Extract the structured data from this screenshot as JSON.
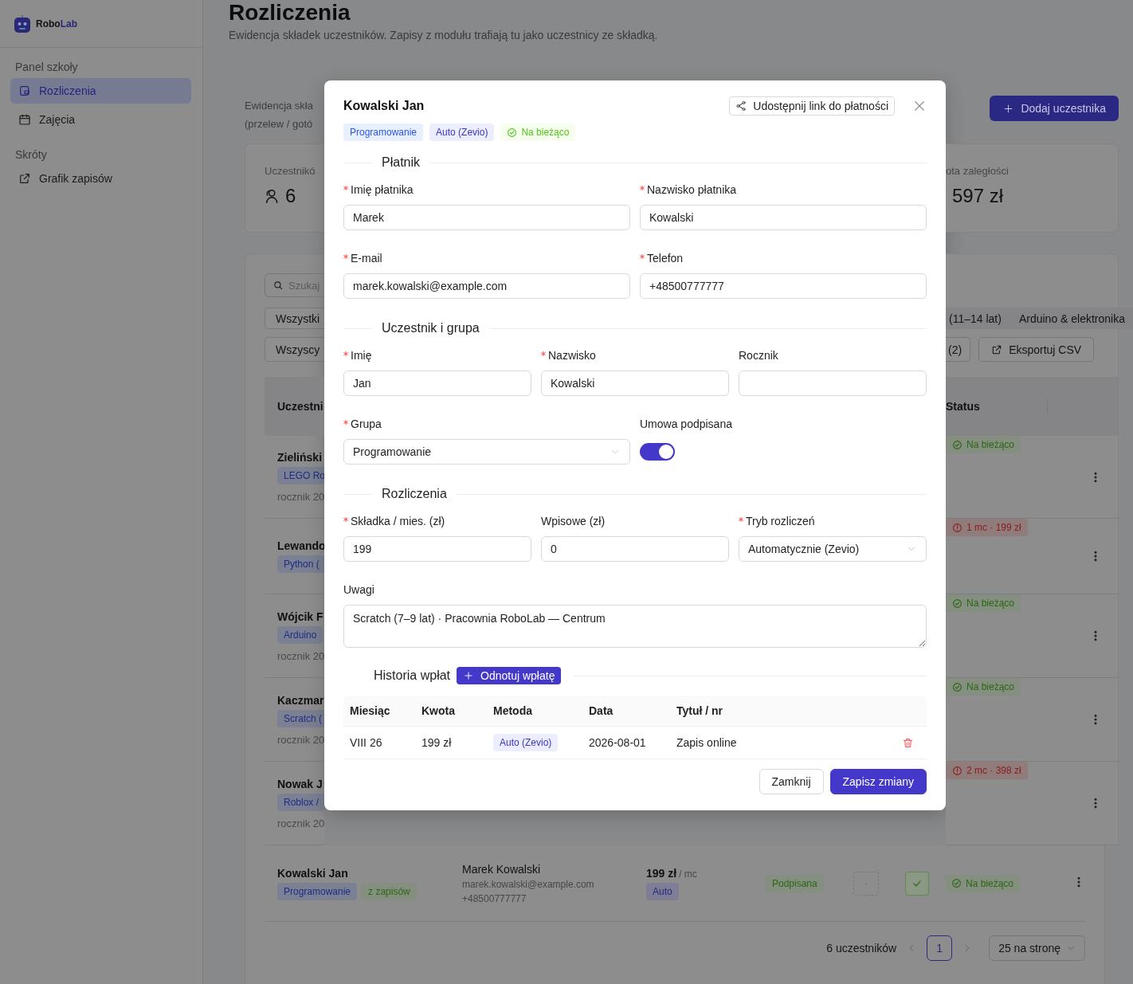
{
  "sidebar": {
    "logo": {
      "brand_1": "Robo",
      "brand_2": "Lab"
    },
    "sections": [
      {
        "title": "Panel szkoły",
        "items": [
          {
            "label": "Rozliczenia",
            "selected": true
          },
          {
            "label": "Zajęcia",
            "selected": false
          }
        ]
      },
      {
        "title": "Skróty",
        "items": [
          {
            "label": "Grafik zapisów",
            "selected": false
          }
        ]
      }
    ]
  },
  "page": {
    "title": "Rozliczenia",
    "subtitle": "Ewidencja składek uczestników. Zapisy z modułu trafiają tu jako uczestnicy ze składką.",
    "description": [
      "Ewidencja skła",
      "(przelew / gotó"
    ],
    "add_button": "Dodaj uczestnika",
    "stats": [
      {
        "label": "Uczestnikó",
        "value": "6"
      },
      {
        "label": "ota zaległości",
        "value": "597 zł"
      }
    ],
    "search": {
      "placeholder": "Szukaj"
    },
    "filters_left": [
      "Wszystki",
      "Wszyscy"
    ],
    "group_filters": [
      "(11–14 lat)",
      "Arduino & elektronika"
    ],
    "count_button": "(2)",
    "export_button": "Eksportuj CSV",
    "columns": [
      "Uczestni",
      "Status"
    ],
    "rows": [
      {
        "name": "Zieliński",
        "group": "LEGO Ro",
        "year": "rocznik 20",
        "status": "Na bieżąco",
        "kind": "ok"
      },
      {
        "name": "Lewando",
        "group": "Python (",
        "status": "1 mc · 199 zł",
        "kind": "overdue"
      },
      {
        "name": "Wójcik F",
        "group": "Arduino",
        "year": "rocznik 20",
        "status": "Na bieżąco",
        "kind": "ok"
      },
      {
        "name": "Kaczmar",
        "group": "Scratch (",
        "year": "rocznik 20",
        "status": "Na bieżąco",
        "kind": "ok"
      },
      {
        "name": "Nowak J",
        "group": "Roblox /",
        "year": "rocznik 20",
        "status": "2 mc · 398 zł",
        "kind": "overdue"
      }
    ],
    "last_row": {
      "name": "Kowalski Jan",
      "tags": [
        {
          "label": "Programowanie",
          "kind": "group"
        },
        {
          "label": "z zapisów",
          "kind": "source"
        }
      ],
      "payer": "Marek Kowalski",
      "email": "marek.kowalski@example.com",
      "phone": "+48500777777",
      "fee": "199 zł",
      "fee_unit": "/ mc",
      "mode": "Auto",
      "contract": "Podpisana",
      "column_6": "·",
      "checked": true,
      "status": "Na bieżąco",
      "kind": "ok"
    },
    "pagination": {
      "total": "6 uczestników",
      "pages": [
        {
          "label": "1",
          "selected": true
        }
      ],
      "page_size": "25 na stronę"
    }
  },
  "modal": {
    "title": "Kowalski Jan",
    "share_button": "Udostępnij link do płatności",
    "tags": [
      {
        "label": "Programowanie",
        "kind": "group"
      },
      {
        "label": "Auto (Zevio)",
        "kind": "method"
      },
      {
        "label": "Na bieżąco",
        "kind": "ok"
      }
    ],
    "sections": [
      {
        "title": "Płatnik",
        "rows": [
          [
            {
              "kind": "input",
              "label": "Imię płatnika",
              "required": true,
              "value": "Marek"
            },
            {
              "kind": "input",
              "label": "Nazwisko płatnika",
              "required": true,
              "value": "Kowalski"
            }
          ],
          [
            {
              "kind": "input",
              "label": "E-mail",
              "required": true,
              "value": "marek.kowalski@example.com"
            },
            {
              "kind": "input",
              "label": "Telefon",
              "required": true,
              "value": "+48500777777"
            }
          ]
        ]
      },
      {
        "title": "Uczestnik i grupa",
        "rows": [
          [
            {
              "kind": "input",
              "label": "Imię",
              "required": true,
              "value": "Jan"
            },
            {
              "kind": "input",
              "label": "Nazwisko",
              "required": true,
              "value": "Kowalski"
            },
            {
              "kind": "input",
              "label": "Rocznik",
              "required": false
            }
          ],
          [
            {
              "kind": "select",
              "label": "Grupa",
              "required": true,
              "value": "Programowanie"
            },
            {
              "kind": "toggle",
              "label": "Umowa podpisana",
              "required": false,
              "on": true
            }
          ]
        ]
      },
      {
        "title": "Rozliczenia",
        "rows": [
          [
            {
              "kind": "input",
              "label": "Składka / mies. (zł)",
              "required": true,
              "value": "199"
            },
            {
              "kind": "input",
              "label": "Wpisowe (zł)",
              "required": false,
              "value": "0"
            },
            {
              "kind": "select",
              "label": "Tryb rozliczeń",
              "required": true,
              "value": "Automatycznie (Zevio)"
            }
          ],
          [
            {
              "kind": "textarea",
              "label": "Uwagi",
              "required": false,
              "value": "Scratch (7–9 lat) · Pracownia RoboLab — Centrum"
            }
          ]
        ]
      }
    ],
    "history": {
      "title": "Historia wpłat",
      "action_button": "Odnotuj wpłatę",
      "columns": [
        "Miesiąc",
        "Kwota",
        "Metoda",
        "Data",
        "Tytuł / nr"
      ],
      "rows": [
        {
          "cells": [
            "VIII 26",
            "199 zł",
            "Auto (Zevio)",
            "2026-08-01",
            "Zapis online"
          ]
        }
      ]
    },
    "buttons": [
      {
        "label": "Zamknij",
        "kind": "secondary"
      },
      {
        "label": "Zapisz zmiany",
        "kind": "primary"
      }
    ]
  }
}
